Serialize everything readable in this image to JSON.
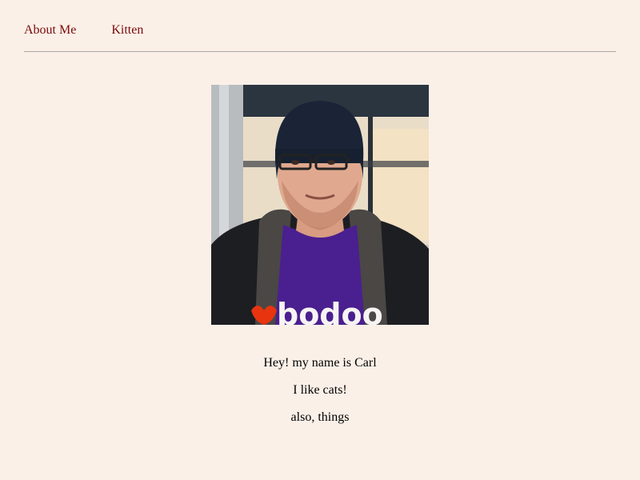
{
  "nav": {
    "items": [
      {
        "label": "About Me"
      },
      {
        "label": "Kitten"
      }
    ]
  },
  "profile": {
    "photo_shirt_text": "bodoo",
    "lines": [
      "Hey! my name is Carl",
      "I like cats!",
      "also, things"
    ]
  },
  "colors": {
    "background": "#fbf0e8",
    "link": "#7a0a0a",
    "divider": "#a8a8a8"
  }
}
